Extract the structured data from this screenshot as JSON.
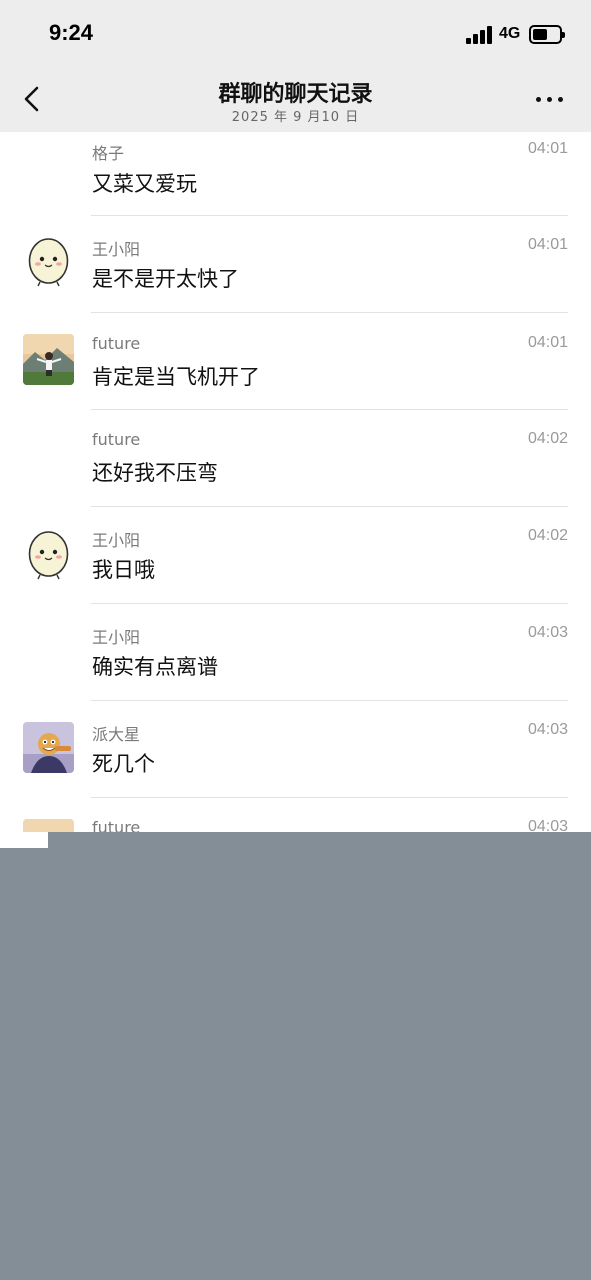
{
  "status": {
    "time": "9:24",
    "network": "4G"
  },
  "nav": {
    "title": "群聊的聊天记录",
    "subtitle": "2025 年 9 月10 日"
  },
  "messages": [
    {
      "sender": "格子",
      "time": "04:01",
      "text": "又菜又爱玩",
      "avatar": "none"
    },
    {
      "sender": "王小阳",
      "time": "04:01",
      "text": "是不是开太快了",
      "avatar": "egg-avatar"
    },
    {
      "sender": "future",
      "time": "04:01",
      "text": "肯定是当飞机开了",
      "avatar": "landscape-person-avatar"
    },
    {
      "sender": "future",
      "time": "04:02",
      "text": "还好我不压弯",
      "avatar": "none"
    },
    {
      "sender": "王小阳",
      "time": "04:02",
      "text": "我日哦",
      "avatar": "egg-avatar"
    },
    {
      "sender": "王小阳",
      "time": "04:03",
      "text": "确实有点离谱",
      "avatar": "none"
    },
    {
      "sender": "派大星",
      "time": "04:03",
      "text": "死几个",
      "avatar": "cartoon-avatar"
    },
    {
      "sender": "future",
      "time": "04:03",
      "text": "",
      "avatar": "landscape-person-avatar"
    }
  ]
}
